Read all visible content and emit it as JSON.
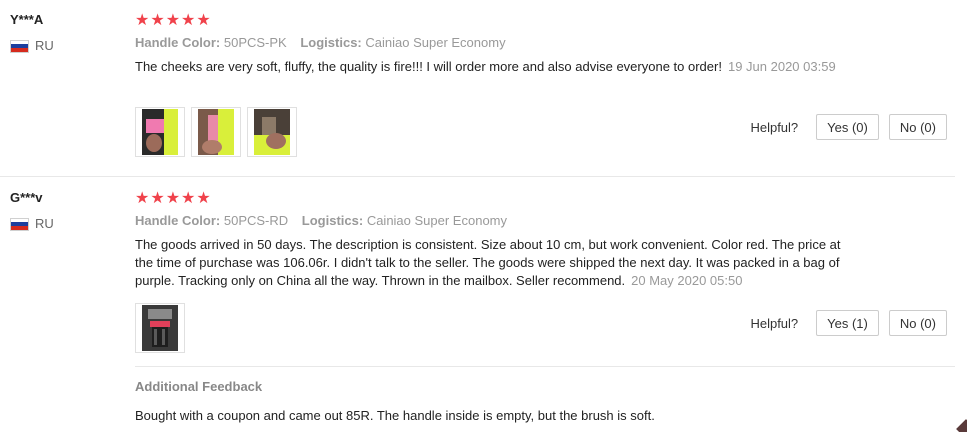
{
  "reviews": [
    {
      "user": "Y***A",
      "country": "RU",
      "stars": "★★★★★",
      "color_label": "Handle Color:",
      "color_value": "50PCS-PK",
      "logistics_label": "Logistics:",
      "logistics_value": "Cainiao Super Economy",
      "text": "The cheeks are very soft, fluffy, the quality is fire!!! I will order more and also advise everyone to order!",
      "date": "19 Jun 2020 03:59",
      "helpful_label": "Helpful?",
      "yes_label": "Yes (0)",
      "no_label": "No (0)"
    },
    {
      "user": "G***v",
      "country": "RU",
      "stars": "★★★★★",
      "color_label": "Handle Color:",
      "color_value": "50PCS-RD",
      "logistics_label": "Logistics:",
      "logistics_value": "Cainiao Super Economy",
      "text": "The goods arrived in 50 days. The description is consistent. Size about 10 cm, but work convenient. Color red. The price at the time of purchase was 106.06r. I didn't talk to the seller. The goods were shipped the next day. It was packed in a bag of purple. Tracking only on China all the way. Thrown in the mailbox. Seller recommend.",
      "date": "20 May 2020 05:50",
      "helpful_label": "Helpful?",
      "yes_label": "Yes (1)",
      "no_label": "No (0)",
      "additional_title": "Additional Feedback",
      "additional_text": "Bought with a coupon and came out 85R. The handle inside is empty, but the brush is soft."
    }
  ],
  "colors": {
    "star": "#f0424b",
    "flag_white": "#ffffff",
    "flag_blue": "#1c3f9e",
    "flag_red": "#d52b1e"
  }
}
